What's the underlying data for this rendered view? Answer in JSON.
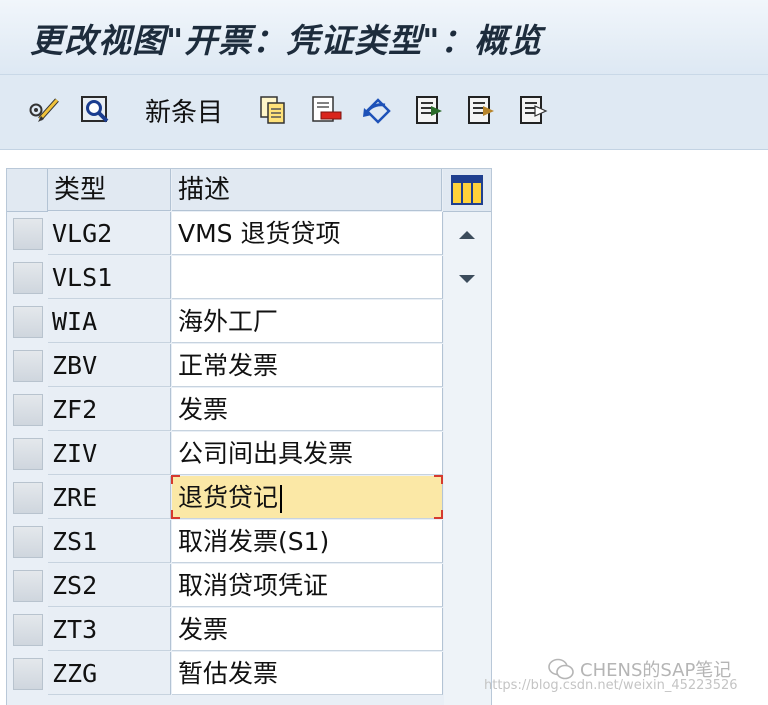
{
  "window": {
    "title": "更改视图\"开票：凭证类型\"：概览"
  },
  "toolbar": {
    "new_entries_label": "新条目"
  },
  "table": {
    "headers": {
      "type": "类型",
      "description": "描述"
    },
    "rows": [
      {
        "type": "VLG2",
        "description": "VMS 退货贷项"
      },
      {
        "type": "VLS1",
        "description": ""
      },
      {
        "type": "WIA",
        "description": "海外工厂"
      },
      {
        "type": "ZBV",
        "description": "正常发票"
      },
      {
        "type": "ZF2",
        "description": "发票"
      },
      {
        "type": "ZIV",
        "description": "公司间出具发票"
      },
      {
        "type": "ZRE",
        "description": "退货贷记"
      },
      {
        "type": "ZS1",
        "description": "取消发票(S1)"
      },
      {
        "type": "ZS2",
        "description": "取消贷项凭证"
      },
      {
        "type": "ZT3",
        "description": "发票"
      },
      {
        "type": "ZZG",
        "description": "暂估发票"
      }
    ],
    "active_row_index": 6
  },
  "watermark": {
    "text": "CHENS的SAP笔记",
    "url": "https://blog.csdn.net/weixin_45223526"
  },
  "colors": {
    "titlebar": "#e8f0f8",
    "toolbar": "#dfe9f3",
    "active_cell": "#fbe8a6",
    "focus_corner": "#d53a2f"
  },
  "icons": [
    "pencil-glasses-icon",
    "magnifier-icon",
    "copy-icon",
    "delete-icon",
    "undo-icon",
    "select-all-icon",
    "select-block-icon",
    "deselect-all-icon",
    "table-settings-icon",
    "scroll-up-icon",
    "scroll-down-icon",
    "wechat-icon"
  ]
}
